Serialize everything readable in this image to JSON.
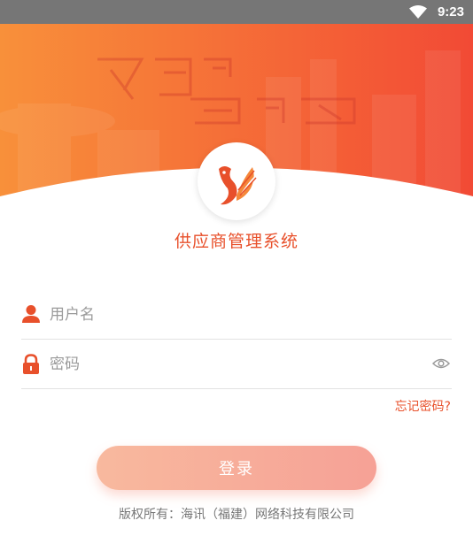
{
  "status_bar": {
    "time": "9:23",
    "wifi_icon": "wifi-icon"
  },
  "banner": {
    "colors": {
      "left": "#f8903a",
      "right": "#f24a35"
    },
    "watermark_text": "飞码导购"
  },
  "logo": {
    "icon": "fox-logo-icon",
    "color": "#e8502b"
  },
  "app": {
    "title": "供应商管理系统"
  },
  "form": {
    "username": {
      "placeholder": "用户名",
      "value": "",
      "icon": "user-icon"
    },
    "password": {
      "placeholder": "密码",
      "value": "",
      "icon": "lock-icon",
      "toggle_icon": "eye-icon"
    },
    "forgot_label": "忘记密码?",
    "login_label": "登录"
  },
  "footer": {
    "copyright": "版权所有：海讯（福建）网络科技有限公司"
  },
  "colors": {
    "accent": "#e8502b",
    "button_start": "#f8b99e",
    "button_end": "#f6a196"
  }
}
